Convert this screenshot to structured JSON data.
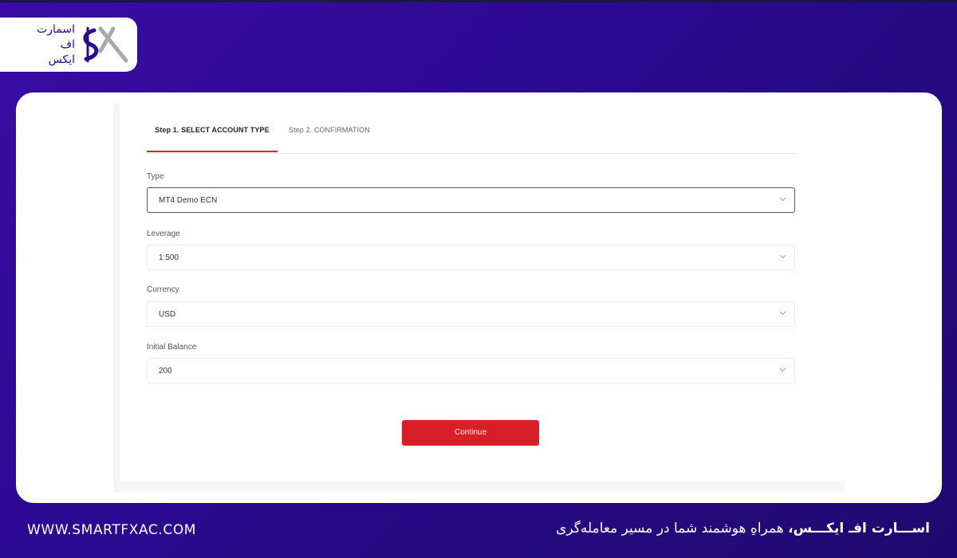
{
  "brand": {
    "logo_line1": "اسمارت",
    "logo_line2": "اف",
    "logo_line3": "ایکس",
    "colors": {
      "primary_purple": "#3a0ca3",
      "accent_red": "#d61f26"
    }
  },
  "form": {
    "tabs": [
      {
        "label": "Step 1. SELECT ACCOUNT TYPE",
        "active": true
      },
      {
        "label": "Step 2. CONFIRMATION",
        "active": false
      }
    ],
    "fields": [
      {
        "label": "Type",
        "value": "MT4 Demo ECN"
      },
      {
        "label": "Leverage",
        "value": "1:500"
      },
      {
        "label": "Currency",
        "value": "USD"
      },
      {
        "label": "Initial Balance",
        "value": "200"
      }
    ],
    "continue_label": "Continue",
    "icons": {
      "dropdown": "chevron-down-icon"
    }
  },
  "footer": {
    "url": "WWW.SMARTFXAC.COM",
    "tagline_bold": "اســـارت افـ ایکـــس،",
    "tagline_rest": " همراهِ هوشمند شما در مسیر معامله‌گری"
  }
}
